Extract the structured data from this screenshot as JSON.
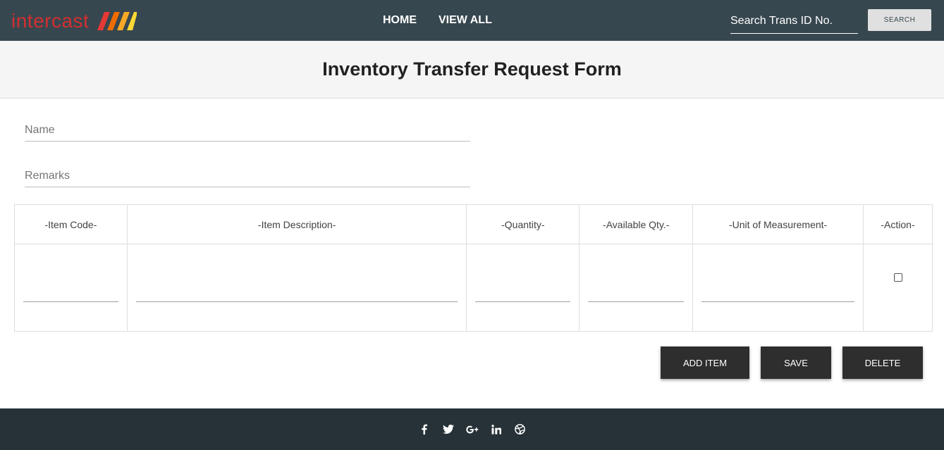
{
  "brand": {
    "name": "intercast",
    "color": "#d32f2f"
  },
  "nav": {
    "home": "HOME",
    "view_all": "VIEW ALL"
  },
  "search": {
    "placeholder": "Search Trans ID No.",
    "button": "SEARCH"
  },
  "page": {
    "title": "Inventory Transfer Request Form"
  },
  "form": {
    "name_placeholder": "Name",
    "remarks_placeholder": "Remarks"
  },
  "table": {
    "headers": [
      "-Item Code-",
      "-Item Description-",
      "-Quantity-",
      "-Available Qty.-",
      "-Unit of Measurement-",
      "-Action-"
    ]
  },
  "actions": {
    "add": "ADD ITEM",
    "save": "SAVE",
    "delete": "DELETE"
  },
  "footer": {
    "social": [
      "facebook-icon",
      "twitter-icon",
      "google-plus-icon",
      "linkedin-icon",
      "dribbble-icon"
    ]
  },
  "colors": {
    "navbar": "#37474f",
    "footer": "#263238",
    "button": "#2e2e2e"
  }
}
